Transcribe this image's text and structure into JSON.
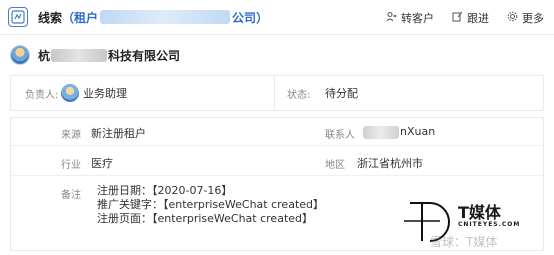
{
  "header": {
    "title_prefix": "线索",
    "title_open": "（",
    "title_linked_start": "租户",
    "title_linked_end": "公司",
    "title_close": "）",
    "actions": [
      {
        "label": "转客户",
        "icon": "transfer-icon"
      },
      {
        "label": "跟进",
        "icon": "edit-icon"
      },
      {
        "label": "更多",
        "icon": "gear-icon"
      }
    ]
  },
  "company": {
    "name_start": "杭",
    "name_end": "科技有限公司"
  },
  "summary": {
    "owner_label": "负责人:",
    "owner_value": "业务助理",
    "status_label": "状态:",
    "status_value": "待分配"
  },
  "details": {
    "source_label": "来源",
    "source_value": "新注册租户",
    "contact_label": "联系人",
    "contact_value": "nXuan",
    "industry_label": "行业",
    "industry_value": "医疗",
    "region_label": "地区",
    "region_value": "浙江省杭州市",
    "notes_label": "备注",
    "notes_lines": [
      "注册日期：【2020-07-16】",
      "推广关键字：【enterpriseWeChat created】",
      "注册页面：【enterpriseWeChat created】"
    ]
  },
  "watermark": {
    "brand": "T媒体",
    "url": "CNITEYES.COM",
    "faint": "雪球：T媒体"
  },
  "colors": {
    "accent": "#2f6cc8",
    "border": "#e6e9ee",
    "label": "#888888"
  }
}
